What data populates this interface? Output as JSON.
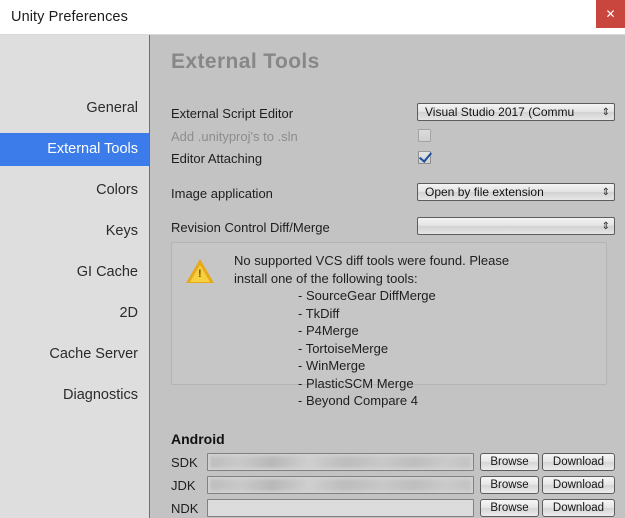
{
  "window": {
    "title": "Unity Preferences",
    "close_label": "✕",
    "accent_blue": "#3b7cea",
    "close_red": "#c9463f",
    "panel_bg": "#c3c3c3",
    "sidebar_bg": "#dedede"
  },
  "sidebar": {
    "items": [
      {
        "label": "General",
        "selected": false
      },
      {
        "label": "External Tools",
        "selected": true
      },
      {
        "label": "Colors",
        "selected": false
      },
      {
        "label": "Keys",
        "selected": false
      },
      {
        "label": "GI Cache",
        "selected": false
      },
      {
        "label": "2D",
        "selected": false
      },
      {
        "label": "Cache Server",
        "selected": false
      },
      {
        "label": "Diagnostics",
        "selected": false
      }
    ]
  },
  "main": {
    "section_title": "External Tools",
    "fields": {
      "script_editor_label": "External Script Editor",
      "script_editor_value": "Visual Studio 2017 (Commu",
      "unityproj_label": "Add .unityproj's to .sln",
      "unityproj_checked": false,
      "editor_attaching_label": "Editor Attaching",
      "editor_attaching_checked": true,
      "image_app_label": "Image application",
      "image_app_value": "Open by file extension",
      "revision_label": "Revision Control Diff/Merge",
      "revision_value": "",
      "dropdown_arrows": "⇕"
    },
    "warning": {
      "line1": "No supported VCS diff tools were found. Please",
      "line2": "install one of the following tools:",
      "tools": [
        "- SourceGear DiffMerge",
        "- TkDiff",
        "- P4Merge",
        "- TortoiseMerge",
        "- WinMerge",
        "- PlasticSCM Merge",
        "- Beyond Compare 4"
      ],
      "icon_glyph": "!",
      "icon_color": "#f7d040"
    },
    "android": {
      "title": "Android",
      "rows": [
        {
          "label": "SDK",
          "value": "",
          "redacted": true,
          "browse": "Browse",
          "download": "Download"
        },
        {
          "label": "JDK",
          "value": "",
          "redacted": true,
          "browse": "Browse",
          "download": "Download"
        },
        {
          "label": "NDK",
          "value": "",
          "redacted": false,
          "browse": "Browse",
          "download": "Download"
        }
      ]
    }
  }
}
